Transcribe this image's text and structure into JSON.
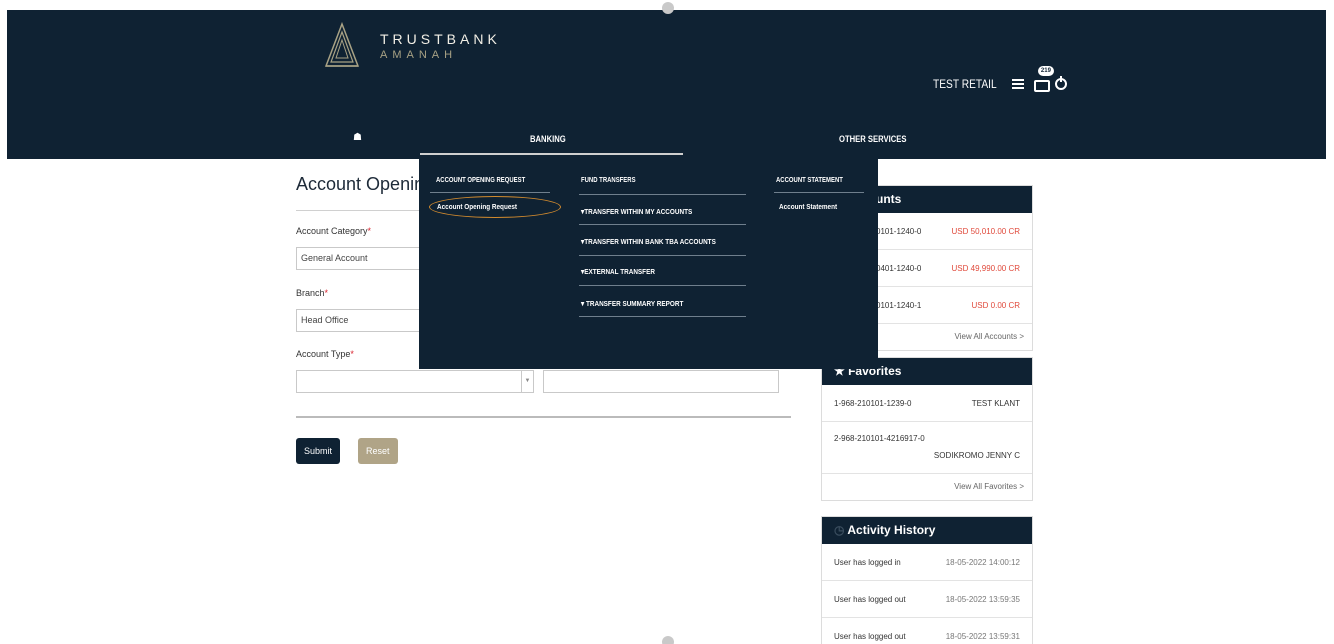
{
  "brand": {
    "name": "TRUSTBANK",
    "sub": "AMANAH"
  },
  "header": {
    "user": "TEST RETAIL",
    "mail_badge": "219"
  },
  "nav": {
    "items": [
      "BANKING",
      "OTHER SERVICES"
    ]
  },
  "mega_menu": {
    "col1_title": "ACCOUNT OPENING REQUEST",
    "col1_link": "Account Opening Request",
    "col2_title": "FUND TRANSFERS",
    "col2_links": [
      "▾TRANSFER WITHIN MY ACCOUNTS",
      "▾TRANSFER WITHIN BANK TBA ACCOUNTS",
      "▾EXTERNAL TRANSFER",
      "▾ TRANSFER SUMMARY REPORT"
    ],
    "col3_title": "ACCOUNT STATEMENT",
    "col3_link": "Account Statement"
  },
  "form": {
    "title": "Account Openin",
    "category_label": "Account Category",
    "category_value": "General Account",
    "branch_label": "Branch",
    "branch_value": "Head Office",
    "type_label": "Account Type",
    "required_mark": "*",
    "submit": "Submit",
    "reset": "Reset"
  },
  "accounts": {
    "title_fragment": "unts",
    "rows": [
      {
        "num": "0101-1240-0",
        "amt": "USD 50,010.00 CR"
      },
      {
        "num": "0401-1240-0",
        "amt": "USD 49,990.00 CR"
      },
      {
        "num": "0101-1240-1",
        "amt": "USD 0.00 CR"
      }
    ],
    "view_all": "View All Accounts  >"
  },
  "favorites": {
    "title": "Favorites",
    "rows": [
      {
        "acct": "1-968-210101-1239-0",
        "name": "TEST KLANT"
      },
      {
        "acct": "2-968-210101-4216917-0",
        "name": "SODIKROMO JENNY C"
      }
    ],
    "view_all": "View All Favorites >"
  },
  "activity": {
    "title": "Activity History",
    "rows": [
      {
        "event": "User has logged in",
        "time": "18-05-2022 14:00:12"
      },
      {
        "event": "User has logged out",
        "time": "18-05-2022 13:59:35"
      },
      {
        "event": "User has logged out",
        "time": "18-05-2022 13:59:31"
      }
    ]
  }
}
